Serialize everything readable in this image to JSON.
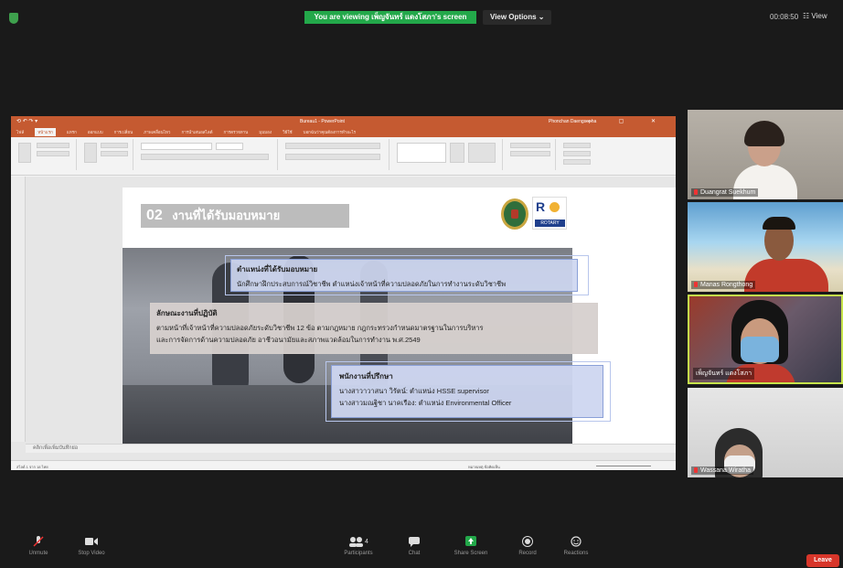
{
  "zoom": {
    "banner": "You are viewing เพ็ญจันทร์ แดงโสภา's screen",
    "view_options": "View Options ⌄",
    "timer": "00:08:50",
    "view_button": "☷ View",
    "leave": "Leave",
    "accent_green": "#23a84a",
    "leave_red": "#d8362a"
  },
  "bottom_bar": [
    {
      "icon": "mic-muted-icon",
      "label": "Unmute"
    },
    {
      "icon": "video-icon",
      "label": "Stop Video"
    },
    {
      "icon": "participants-icon",
      "label": "Participants",
      "count": "4"
    },
    {
      "icon": "chat-icon",
      "label": "Chat"
    },
    {
      "icon": "share-screen-icon",
      "label": "Share Screen"
    },
    {
      "icon": "record-icon",
      "label": "Record"
    },
    {
      "icon": "reactions-icon",
      "label": "Reactions"
    }
  ],
  "participants": [
    {
      "name": "Duangrat Suekhum"
    },
    {
      "name": "Manas Rongthong"
    },
    {
      "name": "เพ็ญจันทร์ แดงโสภา"
    },
    {
      "name": "Wassana Wiratha"
    }
  ],
  "powerpoint": {
    "window_title": "Bureau1 - PowerPoint",
    "user": "Phonchan Daengsopha",
    "accent": "#c55a31",
    "tabs": [
      "ไฟล์",
      "หน้าแรก",
      "แทรก",
      "ออกแบบ",
      "การเปลี่ยน",
      "ภาพเคลื่อนไหว",
      "การนำเสนอสไลด์",
      "การตรวจทาน",
      "มุมมอง",
      "วิธีใช้",
      "บอกฉันว่าคุณต้องการทำอะไร"
    ],
    "notes_placeholder": "คลิกเพื่อเพิ่มบันทึกย่อ",
    "status_left": "สไลด์ 1 จาก 18   ไทย",
    "status_right": "หมายเหตุ   ข้อคิดเห็น",
    "slide": {
      "number": "02",
      "title": "งานที่ได้รับมอบหมาย",
      "rotary_logo_text": "R",
      "rotary_label": "ROTARY",
      "box1": {
        "heading": "ตำแหน่งที่ได้รับมอบหมาย",
        "text": "นักศึกษาฝึกประสบการณ์วิชาชีพ ตำแหน่งเจ้าหน้าที่ความปลอดภัยในการทำงานระดับวิชาชีพ"
      },
      "box2": {
        "heading": "ลักษณะงานที่ปฏิบัติ",
        "line1": "ตามหน้าที่เจ้าหน้าที่ความปลอดภัยระดับวิชาชีพ 12 ข้อ ตามกฎหมาย กฎกระทรวงกำหนดมาตรฐานในการบริหาร",
        "line2": "และการจัดการด้านความปลอดภัย อาชีวอนามัยและสภาพแวดล้อมในการทำงาน พ.ศ.2549"
      },
      "box3": {
        "heading": "พนักงานที่ปรึกษา",
        "line1": "นางสาวาวาสนา วิรัตน์: ตำแหน่ง HSSE  supervisor",
        "line2": "นางสาวมณฐิชา นาคเรือง: ตำแหน่ง Environmental Officer"
      }
    }
  }
}
